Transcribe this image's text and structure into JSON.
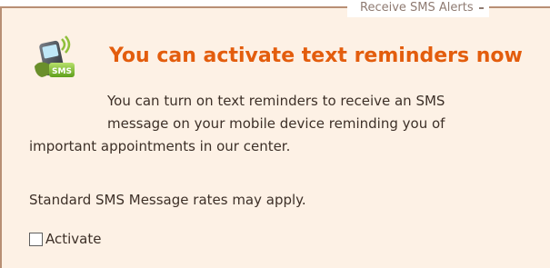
{
  "panel": {
    "legend": "Receive SMS Alerts",
    "icon_name": "sms-phone-icon",
    "icon_text": "SMS",
    "headline": "You can activate text reminders now",
    "body_lines": [
      "You can turn on text reminders to receive an SMS",
      "message on your mobile device reminding you of",
      "important appointments in our center."
    ],
    "rates_note": "Standard SMS Message rates may apply.",
    "activate_label": "Activate",
    "activate_checked": false
  },
  "colors": {
    "headline": "#e35d0d",
    "panel_background": "#fdf1e5",
    "border": "#b88f74",
    "text": "#3d3028"
  }
}
